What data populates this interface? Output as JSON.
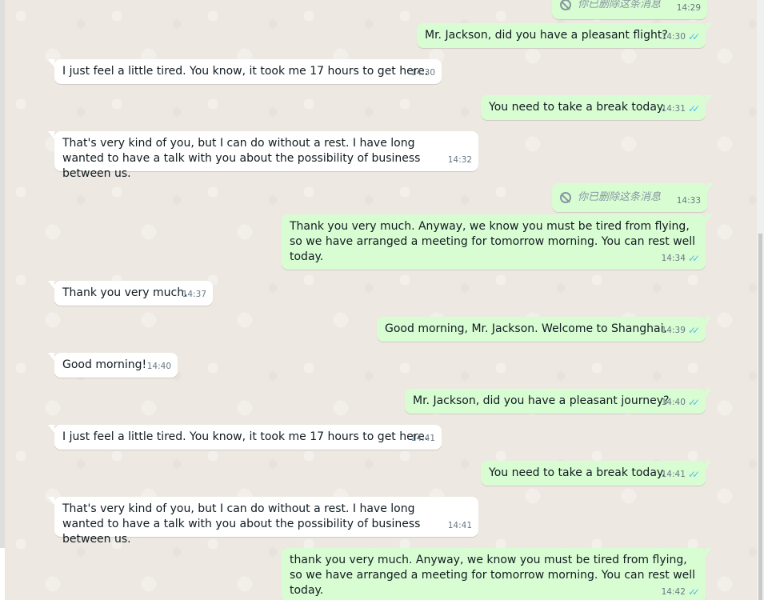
{
  "messages": [
    {
      "id": "m1",
      "dir": "out",
      "deleted": true,
      "text": "你已删除这条消息",
      "time": "14:29"
    },
    {
      "id": "m2",
      "dir": "out",
      "text": "Mr. Jackson, did you have a pleasant flight?",
      "time": "14:30"
    },
    {
      "id": "m3",
      "dir": "in",
      "text": "I just feel a little tired. You know, it took me 17 hours to get here.",
      "time": "14:30"
    },
    {
      "id": "m4",
      "dir": "out",
      "text": "You need to take a break today.",
      "time": "14:31"
    },
    {
      "id": "m5",
      "dir": "in",
      "text": "That's very kind of you, but I can do without a rest. I have long wanted to have a talk with you about the possibility of business between us.",
      "time": "14:32"
    },
    {
      "id": "m6",
      "dir": "out",
      "deleted": true,
      "text": "你已删除这条消息",
      "time": "14:33"
    },
    {
      "id": "m7",
      "dir": "out",
      "text": "Thank you very much. Anyway, we know you must be tired from flying, so we have arranged a meeting for tomorrow morning. You can rest well today.",
      "time": "14:34"
    },
    {
      "id": "m8",
      "dir": "in",
      "text": "Thank you very much.",
      "time": "14:37"
    },
    {
      "id": "m9",
      "dir": "out",
      "text": "Good morning, Mr. Jackson. Welcome to Shanghai.",
      "time": "14:39"
    },
    {
      "id": "m10",
      "dir": "in",
      "text": "Good morning!",
      "time": "14:40"
    },
    {
      "id": "m11",
      "dir": "out",
      "text": "Mr. Jackson, did you have a pleasant journey?",
      "time": "14:40"
    },
    {
      "id": "m12",
      "dir": "in",
      "text": "I just feel a little tired. You know, it took me 17 hours to get here.",
      "time": "14:41"
    },
    {
      "id": "m13",
      "dir": "out",
      "text": "You need to take a break today.",
      "time": "14:41"
    },
    {
      "id": "m14",
      "dir": "in",
      "text": "That's very kind of you, but I can do without a rest. I have long wanted to have a talk with you about the possibility of business between us.",
      "time": "14:41"
    },
    {
      "id": "m15",
      "dir": "out",
      "text": "thank you very much. Anyway, we know you must be tired from flying, so we have arranged a meeting for tomorrow morning. You can rest well today.",
      "time": "14:42"
    }
  ],
  "icons": {
    "read_receipt": "double-check-icon",
    "deleted": "ban-icon"
  },
  "colors": {
    "chat_background": "#ede8e1",
    "incoming_bubble": "#ffffff",
    "outgoing_bubble": "#d9fdd3",
    "read_ticks": "#53bdeb",
    "timestamp": "#667781"
  }
}
